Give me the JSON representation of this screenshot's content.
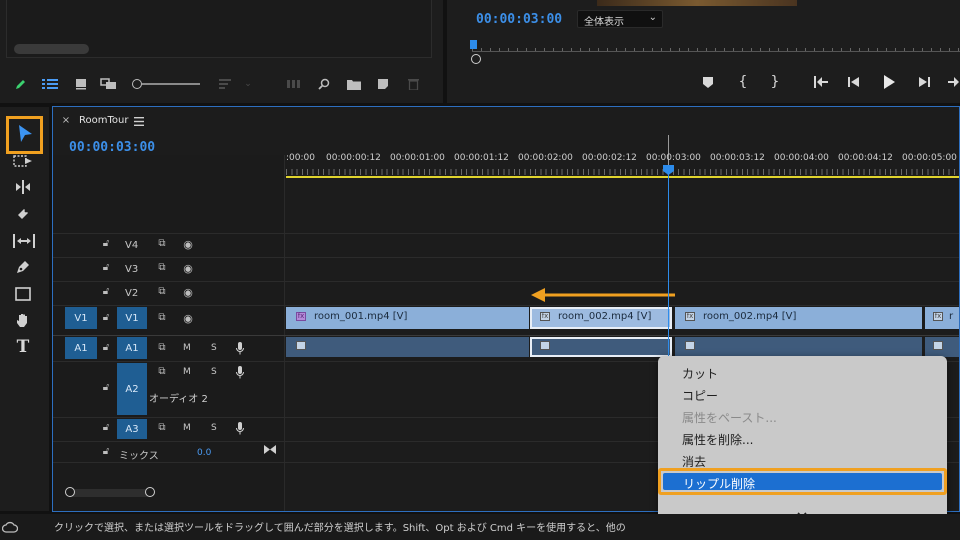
{
  "program_monitor": {
    "timecode": "00:00:03:00",
    "zoom": "全体表示"
  },
  "timeline": {
    "sequence_name": "RoomTour",
    "timecode": "00:00:03:00",
    "ruler_ticks": [
      ":00:00",
      "00:00:00:12",
      "00:00:01:00",
      "00:00:01:12",
      "00:00:02:00",
      "00:00:02:12",
      "00:00:03:00",
      "00:00:03:12",
      "00:00:04:00",
      "00:00:04:12",
      "00:00:05:00"
    ],
    "video_tracks": [
      {
        "name": "V4"
      },
      {
        "name": "V3"
      },
      {
        "name": "V2"
      },
      {
        "name": "V1",
        "source": "V1"
      }
    ],
    "audio_tracks": [
      {
        "name": "A1",
        "source": "A1",
        "m": "M",
        "s": "S"
      },
      {
        "name": "A2",
        "sub": "オーディオ 2",
        "m": "M",
        "s": "S"
      },
      {
        "name": "A3",
        "m": "M",
        "s": "S"
      }
    ],
    "mix": {
      "label": "ミックス",
      "value": "0.0"
    },
    "clips": [
      {
        "name": "room_001.mp4 [V]",
        "fx": "fx"
      },
      {
        "name": "room_002.mp4 [V]",
        "fx": "fx"
      },
      {
        "name": "room_002.mp4 [V]",
        "fx": "fx"
      },
      {
        "name": "r",
        "fx": "fx"
      }
    ]
  },
  "context_menu": {
    "items": [
      {
        "label": "カット",
        "enabled": true
      },
      {
        "label": "コピー",
        "enabled": true
      },
      {
        "label": "属性をペースト...",
        "enabled": false
      },
      {
        "label": "属性を削除...",
        "enabled": true
      },
      {
        "label": "消去",
        "enabled": true
      },
      {
        "label": "リップル削除",
        "enabled": true,
        "highlighted": true
      }
    ],
    "more_icon": "chevron-down-icon"
  },
  "status_bar": {
    "text": "クリックで選択、または選択ツールをドラッグして囲んだ部分を選択します。Shift、Opt および Cmd キーを使用すると、他の"
  },
  "colors": {
    "accent_blue": "#2d8ceb",
    "highlight_orange": "#f0a020",
    "menu_highlight": "#1c6fd1",
    "video_clip": "#8bafd9",
    "audio_clip": "#3f5b7c"
  }
}
